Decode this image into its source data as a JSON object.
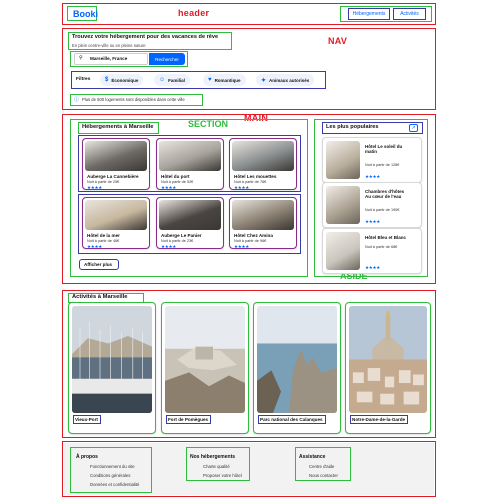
{
  "annotations": {
    "header": "header",
    "nav": "NAV",
    "main": "MAIN",
    "section": "SECTION",
    "aside": "ASIDE"
  },
  "header": {
    "logo": "Booki",
    "nav_links": [
      "Hébergements",
      "Activités"
    ]
  },
  "search": {
    "title": "Trouvez votre hébergement pour des vacances de rêve",
    "subtitle": "En plein centre-ville ou en pleine nature",
    "location_value": "Marseille, France",
    "submit_label": "Rechercher",
    "filters_label": "Filtres",
    "filters": [
      {
        "label": "Économique",
        "icon": "money-icon"
      },
      {
        "label": "Familial",
        "icon": "child-icon"
      },
      {
        "label": "Romantique",
        "icon": "heart-icon"
      },
      {
        "label": "Animaux autorisés",
        "icon": "dog-icon"
      }
    ],
    "info_text": "Plus de 500 logements sont disponibles dans cette ville"
  },
  "hebergements": {
    "title": "Hébergements à Marseille",
    "cards": [
      {
        "name": "Auberge La Cannebière",
        "price": "Nuit à partir de 25€",
        "rating": 4,
        "color": "#6d6a66"
      },
      {
        "name": "Hôtel du port",
        "price": "Nuit à partir de 52€",
        "rating": 4,
        "color": "#a7a39c"
      },
      {
        "name": "Hôtel Les mouettes",
        "price": "Nuit à partir de 76€",
        "rating": 4,
        "color": "#8a8e8f"
      },
      {
        "name": "Hôtel de la mer",
        "price": "Nuit à partir de 46€",
        "rating": 4,
        "color": "#c7b89f"
      },
      {
        "name": "Auberge Le Panier",
        "price": "Nuit à partir de 23€",
        "rating": 4,
        "color": "#4a4542"
      },
      {
        "name": "Hôtel Chez Amina",
        "price": "Nuit à partir de 96€",
        "rating": 4,
        "color": "#8c8173"
      }
    ],
    "show_more": "Afficher plus"
  },
  "populaires": {
    "title": "Les plus populaires",
    "icon": "chart-icon",
    "cards": [
      {
        "name": "Hôtel Le soleil du matin",
        "price": "Nuit à partir de 128€",
        "rating": 4,
        "color": "#b8ad9a"
      },
      {
        "name": "Chambres d'hôtes Au cœur de l'eau",
        "price": "Nuit à partir de 190€",
        "rating": 4,
        "color": "#a99f90"
      },
      {
        "name": "Hôtel Bleu et Blanc",
        "price": "Nuit à partir de 68€",
        "rating": 4,
        "color": "#c9c4bb"
      }
    ]
  },
  "activites": {
    "title": "Activités à Marseille",
    "cards": [
      {
        "label": "Vieux-Port"
      },
      {
        "label": "Fort de Pomègues"
      },
      {
        "label": "Parc national des Calanques"
      },
      {
        "label": "Notre-Dame-de-la-Garde"
      }
    ]
  },
  "footer": {
    "columns": [
      {
        "title": "À propos",
        "links": [
          "Fonctionnement du site",
          "Conditions générales",
          "Données et confidentialité"
        ]
      },
      {
        "title": "Nos hébergements",
        "links": [
          "Charte qualité",
          "Proposer votre hôtel"
        ]
      },
      {
        "title": "Assistance",
        "links": [
          "Centre d'aide",
          "Nous contacter"
        ]
      }
    ]
  },
  "colors": {
    "accent": "#0065fc",
    "annotation_red": "#e01b24",
    "annotation_green": "#2ebd3c",
    "annotation_blue": "#3a3aa8"
  }
}
